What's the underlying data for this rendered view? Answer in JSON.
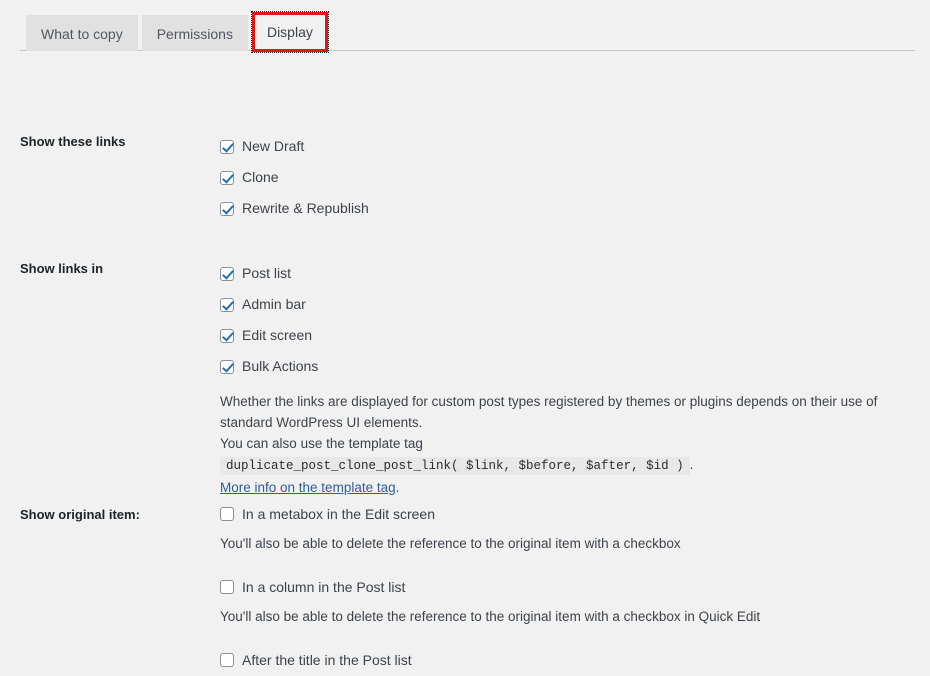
{
  "tabs": [
    {
      "id": "what-to-copy",
      "label": "What to copy",
      "active": false
    },
    {
      "id": "permissions",
      "label": "Permissions",
      "active": false
    },
    {
      "id": "display",
      "label": "Display",
      "active": true
    }
  ],
  "sections": {
    "show_these_links": {
      "label": "Show these links",
      "options": [
        {
          "label": "New Draft",
          "checked": true
        },
        {
          "label": "Clone",
          "checked": true
        },
        {
          "label": "Rewrite & Republish",
          "checked": true
        }
      ]
    },
    "show_links_in": {
      "label": "Show links in",
      "options": [
        {
          "label": "Post list",
          "checked": true
        },
        {
          "label": "Admin bar",
          "checked": true
        },
        {
          "label": "Edit screen",
          "checked": true
        },
        {
          "label": "Bulk Actions",
          "checked": true
        }
      ],
      "description_line1": "Whether the links are displayed for custom post types registered by themes or plugins depends on their use of standard WordPress UI elements.",
      "description_line2_prefix": "You can also use the template tag",
      "template_tag": "duplicate_post_clone_post_link( $link, $before, $after, $id )",
      "description_line2_suffix": ".",
      "link_text": "More info on the template tag",
      "link_suffix": "."
    },
    "show_original_item": {
      "label": "Show original item:",
      "options": [
        {
          "label": "In a metabox in the Edit screen",
          "checked": false,
          "helper": "You'll also be able to delete the reference to the original item with a checkbox"
        },
        {
          "label": "In a column in the Post list",
          "checked": false,
          "helper": "You'll also be able to delete the reference to the original item with a checkbox in Quick Edit"
        },
        {
          "label": "After the title in the Post list",
          "checked": false,
          "helper": ""
        }
      ]
    }
  },
  "colors": {
    "page_background": "#f1f1f1",
    "tab_inactive_background": "#e1e1e1",
    "active_tab_highlight": "#e01818",
    "checkbox_check": "#2271b1",
    "link": "#2d5f94",
    "divider": "#c3c4c7",
    "code_background": "#e8e8e8"
  }
}
